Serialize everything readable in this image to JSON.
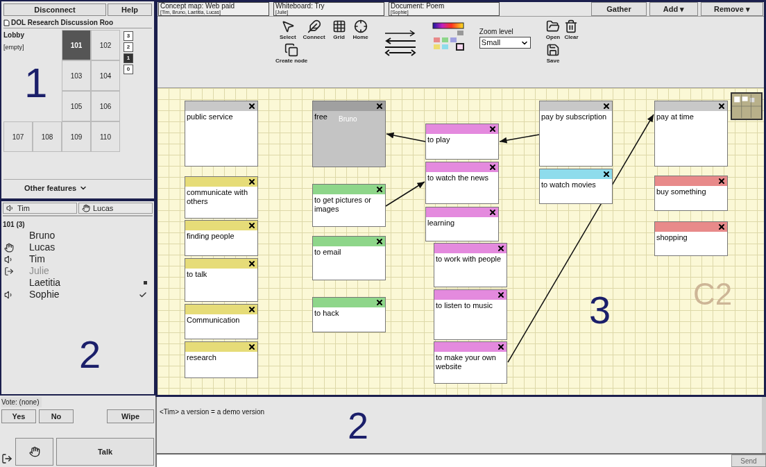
{
  "session": {
    "buttons": [
      "Disconnect",
      "Help"
    ],
    "room_title": "DOL Research Discussion Roo",
    "lobby": {
      "name": "Lobby",
      "status": "[empty]"
    },
    "rooms": [
      {
        "label": "101",
        "selected": true
      },
      {
        "label": "102",
        "selected": false
      },
      {
        "label": "103",
        "selected": false
      },
      {
        "label": "104",
        "selected": false
      },
      {
        "label": "105",
        "selected": false
      },
      {
        "label": "106",
        "selected": false
      },
      {
        "label": "107",
        "selected": false
      },
      {
        "label": "108",
        "selected": false
      },
      {
        "label": "109",
        "selected": false
      },
      {
        "label": "110",
        "selected": false
      }
    ],
    "floors": [
      {
        "label": "3",
        "selected": false
      },
      {
        "label": "2",
        "selected": false
      },
      {
        "label": "1",
        "selected": true
      },
      {
        "label": "0",
        "selected": false
      }
    ],
    "annotation": "1",
    "menu": "Other features"
  },
  "users": {
    "tabs": [
      {
        "label": "Tim",
        "kind": "speaker"
      },
      {
        "label": "Lucas",
        "kind": "hand"
      }
    ],
    "room_header": "101 (3)",
    "list": [
      {
        "name": "Bruno",
        "kind": "plain",
        "disabled": false,
        "dotted": false,
        "checked": false
      },
      {
        "name": "Lucas",
        "kind": "hand",
        "disabled": false,
        "dotted": false,
        "checked": false
      },
      {
        "name": "Tim",
        "kind": "speaker",
        "disabled": false,
        "dotted": false,
        "checked": false
      },
      {
        "name": "Julie",
        "kind": "exit",
        "disabled": true,
        "dotted": false,
        "checked": false
      },
      {
        "name": "Laetitia",
        "kind": "plain",
        "disabled": false,
        "dotted": true,
        "checked": false
      },
      {
        "name": "Sophie",
        "kind": "speaker",
        "disabled": false,
        "dotted": false,
        "checked": true
      }
    ],
    "annotation": "2"
  },
  "vote": {
    "label": "Vote: (none)",
    "buttons": [
      "Yes",
      "No",
      "Wipe"
    ],
    "talk": "Talk"
  },
  "documents": [
    {
      "title": "Concept map: Web paid",
      "members": "[Tim, Bruno, Laetitia, Lucas]"
    },
    {
      "title": "Whiteboard: Try",
      "members": "[Julie]"
    },
    {
      "title": "Document: Poem",
      "members": "[Sophie]"
    }
  ],
  "actions": [
    "Gather",
    "Add ▾",
    "Remove ▾"
  ],
  "toolbar": {
    "tools": [
      "Select",
      "Connect",
      "Grid",
      "Home"
    ],
    "create": "Create node",
    "zoom_label": "Zoom level",
    "zoom_value": "Small",
    "file": [
      "Open",
      "Clear",
      "Save"
    ]
  },
  "canvas": {
    "nodes": [
      {
        "text": "public service",
        "color": "#c8c8c8"
      },
      {
        "text": "communicate with others",
        "color": "#e6dc78"
      },
      {
        "text": "finding people",
        "color": "#e6dc78"
      },
      {
        "text": "to talk",
        "color": "#e6dc78"
      },
      {
        "text": "Communication",
        "color": "#e6dc78"
      },
      {
        "text": "research",
        "color": "#e6dc78"
      },
      {
        "text": "free",
        "color": "#a0a0a0",
        "locked_by": "Bruno"
      },
      {
        "text": "to get pictures or images",
        "color": "#8ed68a"
      },
      {
        "text": "to email",
        "color": "#8ed68a"
      },
      {
        "text": "to hack",
        "color": "#8ed68a"
      },
      {
        "text": "to play",
        "color": "#e48ade"
      },
      {
        "text": "to watch the news",
        "color": "#e48ade"
      },
      {
        "text": "learning",
        "color": "#e48ade"
      },
      {
        "text": "to work with people",
        "color": "#e48ade"
      },
      {
        "text": "to listen to music",
        "color": "#e48ade"
      },
      {
        "text": "to make your own website",
        "color": "#e48ade"
      },
      {
        "text": "pay by subscription",
        "color": "#c8c8c8"
      },
      {
        "text": "to watch movies",
        "color": "#8edcec"
      },
      {
        "text": "pay at time",
        "color": "#c8c8c8"
      },
      {
        "text": "buy something",
        "color": "#e88a8a"
      },
      {
        "text": "shopping",
        "color": "#e88a8a"
      }
    ],
    "region_label": "C2",
    "annotation": "3"
  },
  "chat": {
    "messages": [
      "<Tim> a version = a demo version"
    ],
    "annotation": "2",
    "send": "Send"
  }
}
